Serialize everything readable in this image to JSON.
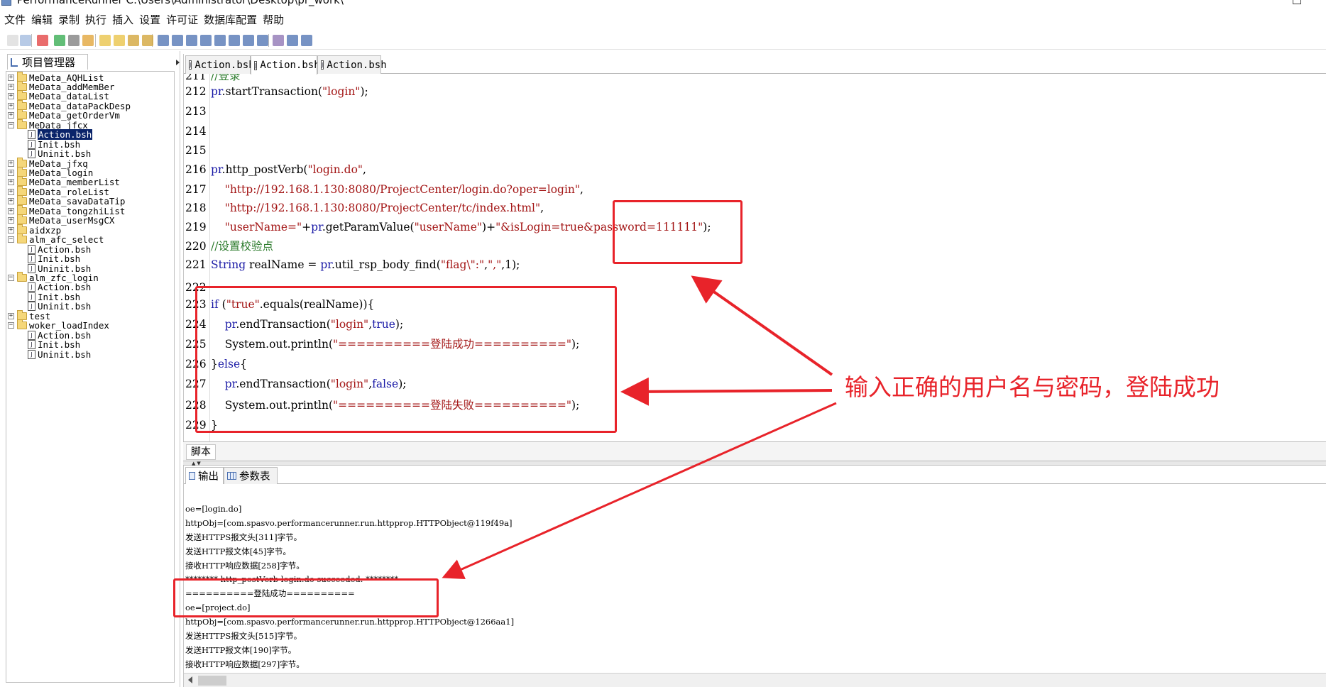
{
  "window": {
    "title": "PerformanceRunner  C:\\Users\\Administrator\\Desktop\\pr_work\\"
  },
  "menu": [
    "文件",
    "编辑",
    "录制",
    "执行",
    "插入",
    "设置",
    "许可证",
    "数据库配置",
    "帮助"
  ],
  "left_panel": {
    "tab_label": "项目管理器",
    "tree": [
      {
        "label": "MeData_AQHList",
        "type": "folder",
        "level": 0,
        "expanded": false
      },
      {
        "label": "MeData_addMemBer",
        "type": "folder",
        "level": 0,
        "expanded": false
      },
      {
        "label": "MeData_dataList",
        "type": "folder",
        "level": 0,
        "expanded": false
      },
      {
        "label": "MeData_dataPackDesp",
        "type": "folder",
        "level": 0,
        "expanded": false
      },
      {
        "label": "MeData_getOrderVm",
        "type": "folder",
        "level": 0,
        "expanded": false
      },
      {
        "label": "MeData_jfcx",
        "type": "folder",
        "level": 0,
        "expanded": true
      },
      {
        "label": "Action.bsh",
        "type": "file",
        "level": 1,
        "selected": true
      },
      {
        "label": "Init.bsh",
        "type": "file",
        "level": 1
      },
      {
        "label": "Uninit.bsh",
        "type": "file",
        "level": 1
      },
      {
        "label": "MeData_jfxq",
        "type": "folder",
        "level": 0,
        "expanded": false
      },
      {
        "label": "MeData_login",
        "type": "folder",
        "level": 0,
        "expanded": false
      },
      {
        "label": "MeData_memberList",
        "type": "folder",
        "level": 0,
        "expanded": false
      },
      {
        "label": "MeData_roleList",
        "type": "folder",
        "level": 0,
        "expanded": false
      },
      {
        "label": "MeData_savaDataTip",
        "type": "folder",
        "level": 0,
        "expanded": false
      },
      {
        "label": "MeData_tongzhiList",
        "type": "folder",
        "level": 0,
        "expanded": false
      },
      {
        "label": "MeData_userMsgCX",
        "type": "folder",
        "level": 0,
        "expanded": false
      },
      {
        "label": "aidxzp",
        "type": "folder",
        "level": 0,
        "expanded": false
      },
      {
        "label": "alm_afc_select",
        "type": "folder",
        "level": 0,
        "expanded": true
      },
      {
        "label": "Action.bsh",
        "type": "file",
        "level": 1
      },
      {
        "label": "Init.bsh",
        "type": "file",
        "level": 1
      },
      {
        "label": "Uninit.bsh",
        "type": "file",
        "level": 1
      },
      {
        "label": "alm_zfc_login",
        "type": "folder",
        "level": 0,
        "expanded": true
      },
      {
        "label": "Action.bsh",
        "type": "file",
        "level": 1
      },
      {
        "label": "Init.bsh",
        "type": "file",
        "level": 1
      },
      {
        "label": "Uninit.bsh",
        "type": "file",
        "level": 1
      },
      {
        "label": "test",
        "type": "folder",
        "level": 0,
        "expanded": false
      },
      {
        "label": "woker_loadIndex",
        "type": "folder",
        "level": 0,
        "expanded": true
      },
      {
        "label": "Action.bsh",
        "type": "file",
        "level": 1
      },
      {
        "label": "Init.bsh",
        "type": "file",
        "level": 1
      },
      {
        "label": "Uninit.bsh",
        "type": "file",
        "level": 1
      }
    ]
  },
  "editor": {
    "tabs": [
      {
        "label": "Action.bsh",
        "active": false
      },
      {
        "label": "Action.bsh",
        "active": true
      },
      {
        "label": "Action.bsh",
        "active": false
      }
    ],
    "lines": [
      {
        "num": "211",
        "html": "<span class=\"cmt\">//登录</span>"
      },
      {
        "num": "212",
        "html": "<span class=\"obj\">pr</span>.startTransaction(<span class=\"str\">\"login\"</span>);"
      },
      {
        "num": "213",
        "html": ""
      },
      {
        "num": "214",
        "html": ""
      },
      {
        "num": "215",
        "html": ""
      },
      {
        "num": "216",
        "html": "<span class=\"obj\">pr</span>.http_postVerb(<span class=\"str\">\"login.do\"</span>,"
      },
      {
        "num": "217",
        "html": "&nbsp;&nbsp;&nbsp;&nbsp;<span class=\"str\">\"http://192.168.1.130:8080/ProjectCenter/login.do?oper=login\"</span>,"
      },
      {
        "num": "218",
        "html": "&nbsp;&nbsp;&nbsp;&nbsp;<span class=\"str\">\"http://192.168.1.130:8080/ProjectCenter/tc/index.html\"</span>,"
      },
      {
        "num": "219",
        "html": "&nbsp;&nbsp;&nbsp;&nbsp;<span class=\"str\">\"userName=\"</span>+<span class=\"obj\">pr</span>.getParamValue(<span class=\"str\">\"userName\"</span>)+<span class=\"str\">\"&amp;isLogin=true&amp;password=111111\"</span>);"
      },
      {
        "num": "220",
        "html": "<span class=\"cmt\">//设置校验点</span>"
      },
      {
        "num": "221",
        "html": "<span class=\"kw\">String</span> realName = <span class=\"obj\">pr</span>.util_rsp_body_find(<span class=\"str\">\"flag\\\":\"</span>,<span class=\"str\">\",\"</span>,1);"
      },
      {
        "num": "222",
        "html": ""
      },
      {
        "num": "223",
        "html": "<span class=\"kw\">if</span> (<span class=\"str\">\"true\"</span>.equals(realName)){"
      },
      {
        "num": "224",
        "html": "&nbsp;&nbsp;&nbsp;&nbsp;<span class=\"obj\">pr</span>.endTransaction(<span class=\"str\">\"login\"</span>,<span class=\"kw\">true</span>);"
      },
      {
        "num": "225",
        "html": "&nbsp;&nbsp;&nbsp;&nbsp;System.out.println(<span class=\"str\">\"==========登陆成功==========\"</span>);"
      },
      {
        "num": "226",
        "html": "}<span class=\"kw\">else</span>{"
      },
      {
        "num": "227",
        "html": "&nbsp;&nbsp;&nbsp;&nbsp;<span class=\"obj\">pr</span>.endTransaction(<span class=\"str\">\"login\"</span>,<span class=\"kw\">false</span>);"
      },
      {
        "num": "228",
        "html": "&nbsp;&nbsp;&nbsp;&nbsp;System.out.println(<span class=\"str\">\"==========登陆失败==========\"</span>);"
      },
      {
        "num": "229",
        "html": "}"
      }
    ]
  },
  "script_tab": "脚本",
  "output": {
    "tabs": [
      {
        "label": "输出",
        "active": true,
        "icon": "output-icon"
      },
      {
        "label": "参数表",
        "active": false,
        "icon": "table-icon"
      }
    ],
    "lines": [
      "",
      "oe=[login.do]",
      "httpObj=[com.spasvo.performancerunner.run.httpprop.HTTPObject@119f49a]",
      "发送HTTPS报文头[311]字节。",
      "发送HTTP报文体[45]字节。",
      "接收HTTP响应数据[258]字节。",
      "********  http_postVerb  login.do  succeeded.  ********",
      "==========登陆成功==========",
      "oe=[project.do]",
      "httpObj=[com.spasvo.performancerunner.run.httpprop.HTTPObject@1266aa1]",
      "发送HTTPS报文头[515]字节。",
      "发送HTTP报文体[190]字节。",
      "接收HTTP响应数据[297]字节。"
    ]
  },
  "annotation": {
    "text": "输入正确的用户名与密码，登陆成功",
    "color": "#e8232a"
  }
}
